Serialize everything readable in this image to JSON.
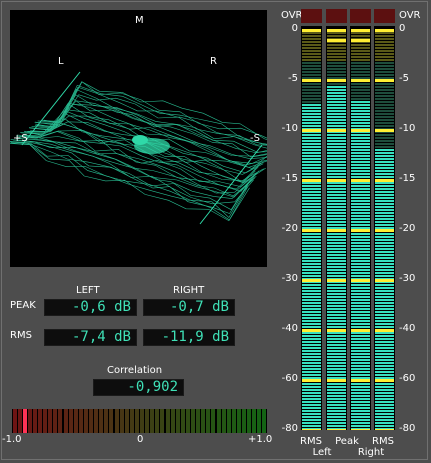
{
  "goniometer": {
    "label_mid": "M",
    "label_left": "L",
    "label_right": "R",
    "label_plus_side": "+S",
    "label_minus_side": "-S",
    "trace_color": "#2fd9a8"
  },
  "levels": {
    "left_header": "LEFT",
    "right_header": "RIGHT",
    "peak_label": "PEAK",
    "rms_label": "RMS",
    "peak_left": "-0,6 dB",
    "peak_right": "-0,7 dB",
    "rms_left": "-7,4 dB",
    "rms_right": "-11,9 dB"
  },
  "correlation": {
    "label": "Correlation",
    "value": "-0,902",
    "value_number": -0.902,
    "tick_min": "-1.0",
    "tick_mid": "0",
    "tick_max": "+1.0"
  },
  "meters": {
    "ovr_label_left": "OVR",
    "ovr_label_right": "OVR",
    "scale": [
      "0",
      "-5",
      "-10",
      "-15",
      "-20",
      "-30",
      "-40",
      "-60",
      "-80"
    ],
    "scale_right": [
      "0",
      "-5",
      "-10",
      "-15",
      "-20",
      "-30",
      "-40",
      "-60",
      "-80"
    ],
    "channels": [
      {
        "id": "rms-left",
        "level_db": -7.4,
        "peak_hold_db": null
      },
      {
        "id": "peak-left",
        "level_db": -5.6,
        "peak_hold_db": -1.0
      },
      {
        "id": "peak-right",
        "level_db": -7.0,
        "peak_hold_db": -1.0
      },
      {
        "id": "rms-right",
        "level_db": -11.9,
        "peak_hold_db": null
      }
    ],
    "bottom_labels": {
      "rms1": "RMS",
      "peak": "Peak",
      "rms2": "RMS",
      "left": "Left",
      "right": "Right"
    },
    "colors": {
      "active": "#38e0c0",
      "inactive": "#1e4d3c",
      "inactive_top": "#5a5a18",
      "marker": "#ffee33",
      "ovr": "#5c1010"
    }
  }
}
